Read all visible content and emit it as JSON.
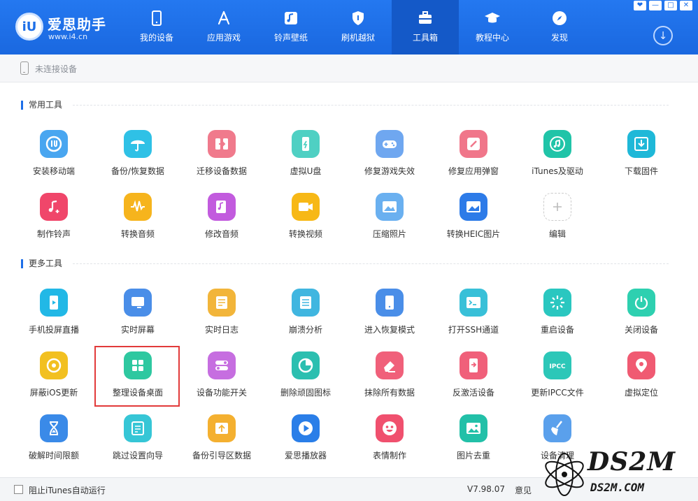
{
  "header": {
    "logo_badge": "iU",
    "logo_name": "爱思助手",
    "logo_url": "www.i4.cn",
    "nav": [
      {
        "label": "我的设备"
      },
      {
        "label": "应用游戏"
      },
      {
        "label": "铃声壁纸"
      },
      {
        "label": "刷机越狱"
      },
      {
        "label": "工具箱",
        "active": true
      },
      {
        "label": "教程中心"
      },
      {
        "label": "发现"
      }
    ],
    "window_buttons": [
      "❤",
      "—",
      "□",
      "✕"
    ],
    "download_icon": "↓"
  },
  "device_bar": {
    "status": "未连接设备"
  },
  "sections": {
    "common_title": "常用工具",
    "more_title": "更多工具"
  },
  "common_tools": [
    {
      "label": "安装移动端",
      "color": "#49a6f0",
      "icon": "i4-logo-icon"
    },
    {
      "label": "备份/恢复数据",
      "color": "#2fc1e6",
      "icon": "umbrella-icon"
    },
    {
      "label": "迁移设备数据",
      "color": "#f07a8c",
      "icon": "migrate-icon"
    },
    {
      "label": "虚拟U盘",
      "color": "#4fd0c3",
      "icon": "usb-drive-icon"
    },
    {
      "label": "修复游戏失效",
      "color": "#6fa7f0",
      "icon": "gamepad-icon"
    },
    {
      "label": "修复应用弹窗",
      "color": "#f0768a",
      "icon": "app-repair-icon"
    },
    {
      "label": "iTunes及驱动",
      "color": "#20c4a8",
      "icon": "itunes-icon"
    },
    {
      "label": "下载固件",
      "color": "#1fb8d8",
      "icon": "firmware-download-icon"
    },
    {
      "label": "制作铃声",
      "color": "#f0466a",
      "icon": "ringtone-icon"
    },
    {
      "label": "转换音频",
      "color": "#f6b41d",
      "icon": "audio-wave-icon"
    },
    {
      "label": "修改音频",
      "color": "#c25bde",
      "icon": "audio-edit-icon"
    },
    {
      "label": "转换视频",
      "color": "#f7b816",
      "icon": "video-convert-icon"
    },
    {
      "label": "压缩照片",
      "color": "#6ab0f0",
      "icon": "photo-compress-icon"
    },
    {
      "label": "转换HEIC图片",
      "color": "#2d7be8",
      "icon": "heic-convert-icon"
    },
    {
      "label": "编辑",
      "color": "#cccccc",
      "icon": "plus-icon"
    }
  ],
  "more_tools": [
    {
      "label": "手机投屏直播",
      "color": "#22b8e6",
      "icon": "screen-cast-icon"
    },
    {
      "label": "实时屏幕",
      "color": "#4a8ee8",
      "icon": "realtime-screen-icon"
    },
    {
      "label": "实时日志",
      "color": "#f2b53a",
      "icon": "log-icon"
    },
    {
      "label": "崩溃分析",
      "color": "#40b6e0",
      "icon": "crash-analysis-icon"
    },
    {
      "label": "进入恢复模式",
      "color": "#4a8ee8",
      "icon": "recovery-mode-icon"
    },
    {
      "label": "打开SSH通道",
      "color": "#38c0d8",
      "icon": "ssh-terminal-icon"
    },
    {
      "label": "重启设备",
      "color": "#2ac7c0",
      "icon": "restart-icon"
    },
    {
      "label": "关闭设备",
      "color": "#2ed0b0",
      "icon": "power-icon"
    },
    {
      "label": "屏蔽iOS更新",
      "color": "#f2c020",
      "icon": "block-update-icon"
    },
    {
      "label": "整理设备桌面",
      "color": "#2ec8a0",
      "icon": "grid-desktop-icon"
    },
    {
      "label": "设备功能开关",
      "color": "#c66ee0",
      "icon": "toggle-switch-icon"
    },
    {
      "label": "删除顽固图标",
      "color": "#2cbfb0",
      "icon": "delete-icon"
    },
    {
      "label": "抹除所有数据",
      "color": "#f0607a",
      "icon": "eraser-icon"
    },
    {
      "label": "反激活设备",
      "color": "#f0607a",
      "icon": "deactivate-icon"
    },
    {
      "label": "更新IPCC文件",
      "color": "#2cc7b8",
      "icon": "ipcc-icon",
      "badge": "IPCC"
    },
    {
      "label": "虚拟定位",
      "color": "#f05a72",
      "icon": "location-pin-icon"
    },
    {
      "label": "破解时间限额",
      "color": "#3a8ae8",
      "icon": "hourglass-icon"
    },
    {
      "label": "跳过设置向导",
      "color": "#36c6d6",
      "icon": "skip-wizard-icon"
    },
    {
      "label": "备份引导区数据",
      "color": "#f4b030",
      "icon": "backup-boot-icon"
    },
    {
      "label": "爱思播放器",
      "color": "#2a7ee8",
      "icon": "player-icon"
    },
    {
      "label": "表情制作",
      "color": "#f0506e",
      "icon": "emoji-icon"
    },
    {
      "label": "图片去重",
      "color": "#22c0a8",
      "icon": "photo-dedupe-icon"
    },
    {
      "label": "设备清理",
      "color": "#5aa0ec",
      "icon": "broom-icon"
    }
  ],
  "footer": {
    "itunes_label": "阻止iTunes自动运行",
    "version": "V7.98.07",
    "feedback": "意见"
  },
  "watermark": {
    "brand": "DS2M",
    "site": "DS2M.COM"
  }
}
